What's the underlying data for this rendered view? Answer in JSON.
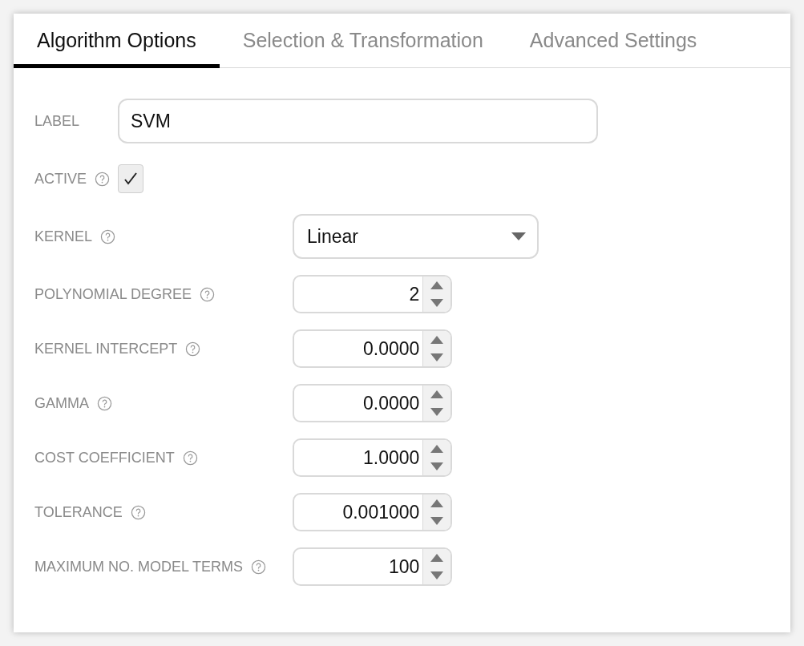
{
  "tabs": [
    {
      "label": "Algorithm Options",
      "selected": true
    },
    {
      "label": "Selection & Transformation",
      "selected": false
    },
    {
      "label": "Advanced Settings",
      "selected": false
    }
  ],
  "fields": [
    {
      "kind": "text",
      "label": "LABEL",
      "help": false,
      "value": "SVM"
    },
    {
      "kind": "checkbox",
      "label": "ACTIVE",
      "help": true,
      "checked": true
    },
    {
      "kind": "select",
      "label": "KERNEL",
      "help": true,
      "value": "Linear"
    },
    {
      "kind": "number",
      "label": "POLYNOMIAL DEGREE",
      "help": true,
      "value": "2"
    },
    {
      "kind": "number",
      "label": "KERNEL INTERCEPT",
      "help": true,
      "value": "0.0000"
    },
    {
      "kind": "number",
      "label": "GAMMA",
      "help": true,
      "value": "0.0000"
    },
    {
      "kind": "number",
      "label": "COST COEFFICIENT",
      "help": true,
      "value": "1.0000"
    },
    {
      "kind": "number",
      "label": "TOLERANCE",
      "help": true,
      "value": "0.001000"
    },
    {
      "kind": "number",
      "label": "MAXIMUM NO. MODEL TERMS",
      "help": true,
      "value": "100"
    }
  ]
}
